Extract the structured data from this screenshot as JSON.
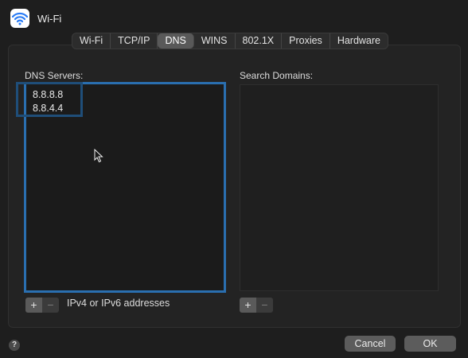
{
  "window": {
    "title": "Wi-Fi",
    "icon": "wifi-icon"
  },
  "tabs": [
    {
      "label": "Wi-Fi"
    },
    {
      "label": "TCP/IP"
    },
    {
      "label": "DNS",
      "active": true
    },
    {
      "label": "WINS"
    },
    {
      "label": "802.1X"
    },
    {
      "label": "Proxies"
    },
    {
      "label": "Hardware"
    }
  ],
  "dns": {
    "label": "DNS Servers:",
    "servers": [
      "8.8.8.8",
      "8.8.4.4"
    ],
    "add_label": "+",
    "remove_label": "−",
    "hint": "IPv4 or IPv6 addresses"
  },
  "search": {
    "label": "Search Domains:",
    "add_label": "+",
    "remove_label": "−"
  },
  "footer": {
    "help_label": "?",
    "cancel_label": "Cancel",
    "ok_label": "OK"
  },
  "colors": {
    "accent": "#2a6fb0",
    "background": "#1e1e1e"
  }
}
